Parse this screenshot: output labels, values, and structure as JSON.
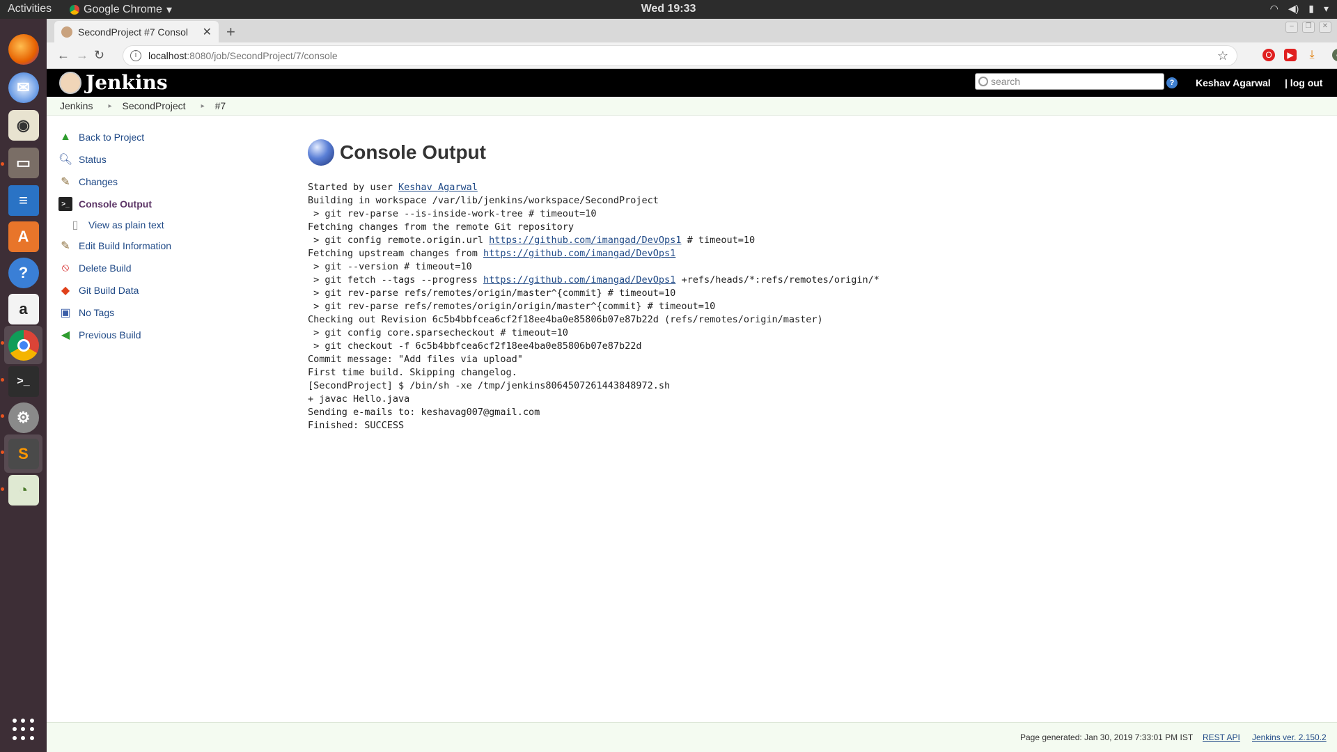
{
  "os": {
    "activities": "Activities",
    "app_name": "Google Chrome",
    "clock": "Wed 19:33"
  },
  "browser": {
    "tab_title": "SecondProject #7 Consol",
    "url_host": "localhost",
    "url_rest": ":8080/job/SecondProject/7/console"
  },
  "jenkins": {
    "logo_text": "Jenkins",
    "search_placeholder": "search",
    "user": "Keshav Agarwal",
    "logout": "| log out"
  },
  "breadcrumbs": [
    "Jenkins",
    "SecondProject",
    "#7"
  ],
  "sidebar": [
    {
      "label": "Back to Project"
    },
    {
      "label": "Status"
    },
    {
      "label": "Changes"
    },
    {
      "label": "Console Output"
    },
    {
      "label": "View as plain text"
    },
    {
      "label": "Edit Build Information"
    },
    {
      "label": "Delete Build"
    },
    {
      "label": "Git Build Data"
    },
    {
      "label": "No Tags"
    },
    {
      "label": "Previous Build"
    }
  ],
  "main": {
    "title": "Console Output",
    "console": {
      "l1_a": "Started by user ",
      "l1_link": "Keshav Agarwal",
      "l2": "Building in workspace /var/lib/jenkins/workspace/SecondProject",
      "l3": " > git rev-parse --is-inside-work-tree # timeout=10",
      "l4": "Fetching changes from the remote Git repository",
      "l5_a": " > git config remote.origin.url ",
      "l5_link": "https://github.com/imangad/DevOps1",
      "l5_b": " # timeout=10",
      "l6_a": "Fetching upstream changes from ",
      "l6_link": "https://github.com/imangad/DevOps1",
      "l7": " > git --version # timeout=10",
      "l8_a": " > git fetch --tags --progress ",
      "l8_link": "https://github.com/imangad/DevOps1",
      "l8_b": " +refs/heads/*:refs/remotes/origin/*",
      "l9": " > git rev-parse refs/remotes/origin/master^{commit} # timeout=10",
      "l10": " > git rev-parse refs/remotes/origin/origin/master^{commit} # timeout=10",
      "l11": "Checking out Revision 6c5b4bbfcea6cf2f18ee4ba0e85806b07e87b22d (refs/remotes/origin/master)",
      "l12": " > git config core.sparsecheckout # timeout=10",
      "l13": " > git checkout -f 6c5b4bbfcea6cf2f18ee4ba0e85806b07e87b22d",
      "l14": "Commit message: \"Add files via upload\"",
      "l15": "First time build. Skipping changelog.",
      "l16": "[SecondProject] $ /bin/sh -xe /tmp/jenkins8064507261443848972.sh",
      "l17": "+ javac Hello.java",
      "l18": "Sending e-mails to: keshavag007@gmail.com",
      "l19": "Finished: SUCCESS"
    }
  },
  "footer": {
    "generated": "Page generated: Jan 30, 2019 7:33:01 PM IST",
    "rest_api": "REST API",
    "version": "Jenkins ver. 2.150.2"
  }
}
